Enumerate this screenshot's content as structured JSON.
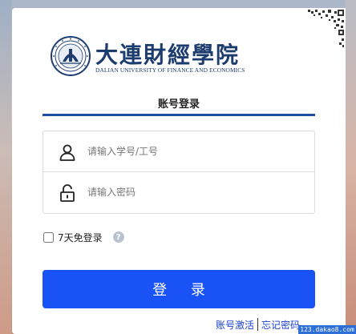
{
  "logo": {
    "name_cn": "大連財經學院",
    "name_en": "DALIAN UNIVERSITY OF FINANCE AND ECONOMICS"
  },
  "tabs": [
    {
      "label": "账号登录"
    }
  ],
  "form": {
    "username_placeholder": "请输入学号/工号",
    "password_placeholder": "请输入密码",
    "remember_label": "7天免登录",
    "help_icon": "?",
    "login_button": "登 录"
  },
  "links": {
    "activate": "账号激活",
    "forgot": "忘记密码"
  },
  "watermark": "123.dakao8.com",
  "colors": {
    "accent": "#1a53f5",
    "tab_underline": "#1e4fa3",
    "logo": "#1d3c6e",
    "link": "#1a3fd6"
  }
}
